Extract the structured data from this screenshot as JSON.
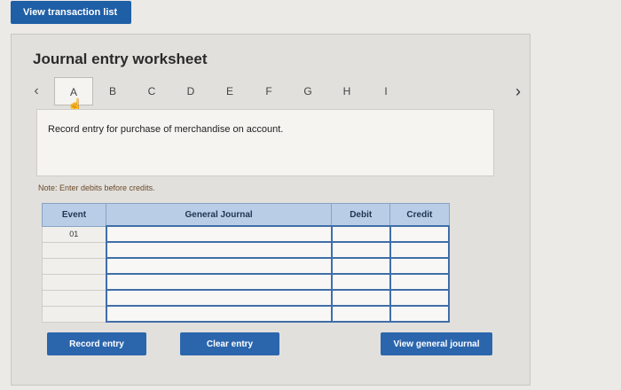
{
  "header": {
    "view_list_label": "View transaction list"
  },
  "worksheet": {
    "title": "Journal entry worksheet",
    "tabs": [
      "A",
      "B",
      "C",
      "D",
      "E",
      "F",
      "G",
      "H",
      "I"
    ],
    "active_tab": "A",
    "description": "Record entry for purchase of merchandise on account.",
    "note": "Note: Enter debits before credits.",
    "table": {
      "headers": {
        "event": "Event",
        "general_journal": "General Journal",
        "debit": "Debit",
        "credit": "Credit"
      },
      "rows": [
        {
          "event": "01"
        },
        {
          "event": ""
        },
        {
          "event": ""
        },
        {
          "event": ""
        },
        {
          "event": ""
        },
        {
          "event": ""
        }
      ]
    },
    "buttons": {
      "record": "Record entry",
      "clear": "Clear entry",
      "view_general": "View general journal"
    }
  },
  "icons": {
    "prev": "chevron-left-icon",
    "next": "chevron-right-icon",
    "cursor": "hand-pointer-icon"
  }
}
